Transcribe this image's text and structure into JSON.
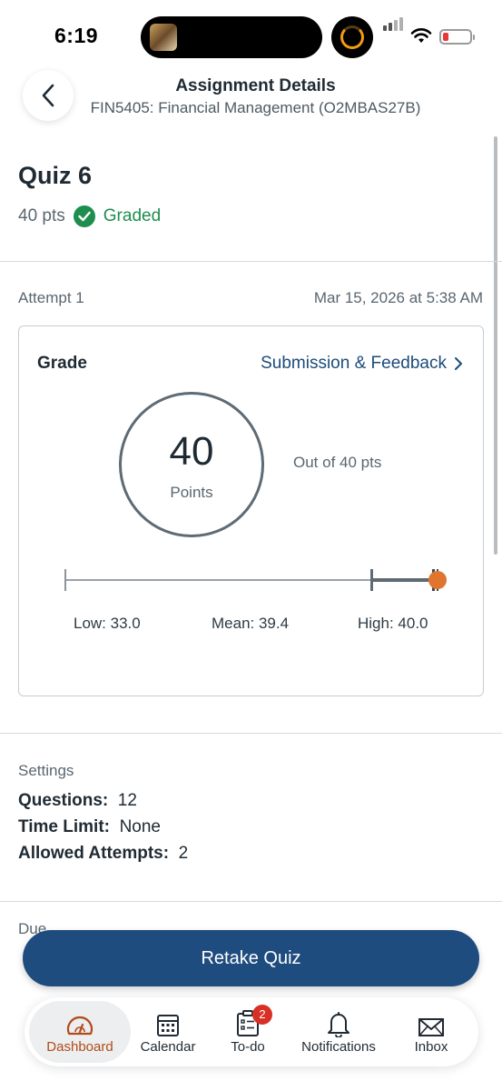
{
  "status_bar": {
    "time": "6:19",
    "battery_level": 0.2
  },
  "header": {
    "title": "Assignment Details",
    "subtitle": "FIN5405: Financial Management (O2MBAS27B)"
  },
  "assignment": {
    "title": "Quiz 6",
    "points": "40 pts",
    "status": "Graded"
  },
  "attempt": {
    "label": "Attempt 1",
    "date": "Mar 15, 2026 at 5:38 AM"
  },
  "grade": {
    "label": "Grade",
    "feedback_link": "Submission & Feedback",
    "score": "40",
    "score_unit": "Points",
    "out_of": "Out of 40 pts",
    "stats": {
      "low": "Low: 33.0",
      "mean": "Mean: 39.4",
      "high": "High: 40.0"
    }
  },
  "settings": {
    "label": "Settings",
    "questions_label": "Questions:",
    "questions_value": "12",
    "time_limit_label": "Time Limit:",
    "time_limit_value": "None",
    "attempts_label": "Allowed Attempts:",
    "attempts_value": "2"
  },
  "due": {
    "label": "Due"
  },
  "retake_button": "Retake Quiz",
  "tabs": [
    {
      "label": "Dashboard",
      "icon": "dashboard-icon",
      "active": true
    },
    {
      "label": "Calendar",
      "icon": "calendar-icon"
    },
    {
      "label": "To-do",
      "icon": "todo-icon",
      "badge": "2"
    },
    {
      "label": "Notifications",
      "icon": "bell-icon"
    },
    {
      "label": "Inbox",
      "icon": "mail-icon"
    }
  ],
  "colors": {
    "accent": "#1f4c7f",
    "link": "#1c4b7a",
    "success": "#1e8e4f",
    "score_marker": "#e0762e",
    "active_tab": "#b24b1a",
    "badge": "#d93025"
  }
}
